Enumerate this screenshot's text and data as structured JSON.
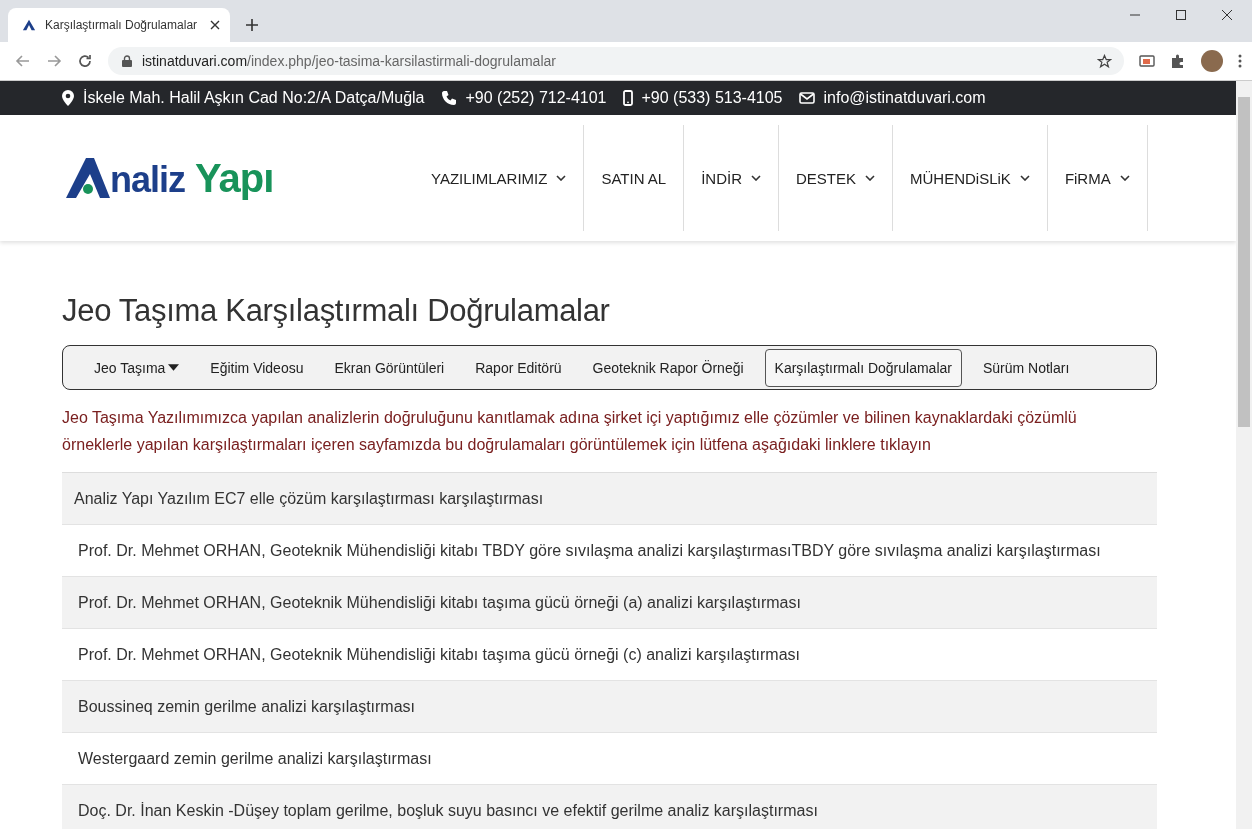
{
  "browser": {
    "tab_title": "Karşılaştırmalı Doğrulamalar",
    "url_host": "istinatduvari.com",
    "url_path": "/index.php/jeo-tasima-karsilastirmali-dogrulamalar"
  },
  "topbar": [
    {
      "kind": "pin",
      "text": "İskele Mah. Halil Aşkın Cad No:2/A Datça/Muğla"
    },
    {
      "kind": "phone",
      "text": "+90 (252) 712-4101"
    },
    {
      "kind": "mobile",
      "text": "+90 (533) 513-4105"
    },
    {
      "kind": "mail",
      "text": "info@istinatduvari.com"
    }
  ],
  "logo": {
    "text_1": "naliz",
    "text_2": "Yapı"
  },
  "nav": [
    {
      "label": "YAZILIMLARIMIZ",
      "dropdown": true
    },
    {
      "label": "SATIN AL",
      "dropdown": false
    },
    {
      "label": "İNDİR",
      "dropdown": true
    },
    {
      "label": "DESTEK",
      "dropdown": true
    },
    {
      "label": "MÜHENDiSLiK",
      "dropdown": true
    },
    {
      "label": "FiRMA",
      "dropdown": true
    }
  ],
  "page_title": "Jeo Taşıma Karşılaştırmalı Doğrulamalar",
  "subnav": [
    {
      "label": "Jeo Taşıma",
      "dropdown": true,
      "selected": false
    },
    {
      "label": "Eğitim Videosu",
      "dropdown": false,
      "selected": false
    },
    {
      "label": "Ekran Görüntüleri",
      "dropdown": false,
      "selected": false
    },
    {
      "label": "Rapor Editörü",
      "dropdown": false,
      "selected": false
    },
    {
      "label": "Geoteknik Rapor Örneği",
      "dropdown": false,
      "selected": false
    },
    {
      "label": "Karşılaştırmalı Doğrulamalar",
      "dropdown": false,
      "selected": true
    },
    {
      "label": "Sürüm Notları",
      "dropdown": false,
      "selected": false
    }
  ],
  "intro": "Jeo Taşıma Yazılımımızca yapılan analizlerin doğruluğunu kanıtlamak adına şirket içi yaptığımız elle çözümler ve bilinen kaynaklardaki çözümlü örneklerle yapılan karşılaştırmaları içeren sayfamızda bu doğrulamaları görüntülemek için lütfena aşağıdaki linklere tıklayın",
  "links": [
    "Analiz Yapı Yazılım EC7 elle çözüm karşılaştırması karşılaştırması",
    "Prof. Dr. Mehmet ORHAN, Geoteknik Mühendisliği kitabı TBDY göre sıvılaşma analizi karşılaştırmasıTBDY göre sıvılaşma analizi karşılaştırması",
    "Prof. Dr. Mehmet ORHAN, Geoteknik Mühendisliği kitabı taşıma gücü örneği (a) analizi karşılaştırması",
    "Prof. Dr. Mehmet ORHAN, Geoteknik Mühendisliği kitabı taşıma gücü örneği (c) analizi karşılaştırması",
    "Boussineq zemin gerilme analizi karşılaştırması",
    "Westergaard zemin gerilme analizi karşılaştırması",
    "Doç. Dr. İnan Keskin -Düşey toplam gerilme, boşluk suyu basıncı ve efektif gerilme analiz karşılaştırması"
  ]
}
